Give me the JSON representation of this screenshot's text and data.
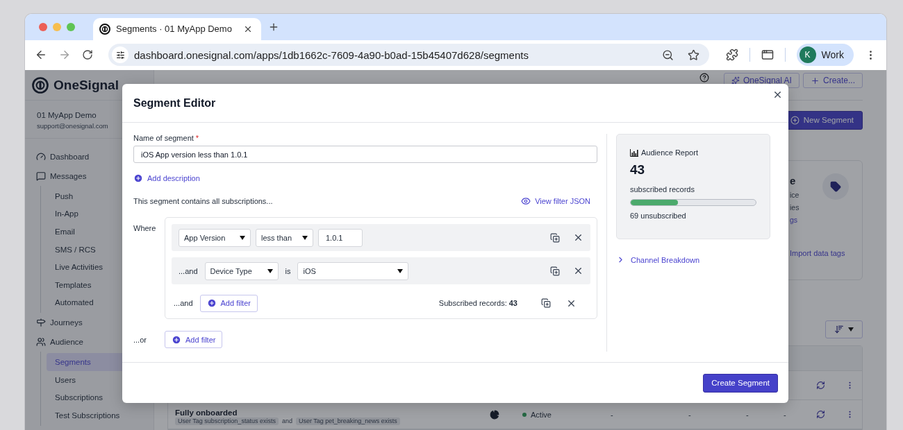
{
  "browser": {
    "tabs": [
      {
        "title": "Segments · 01 MyApp Demo",
        "selected": true
      }
    ],
    "url": "dashboard.onesignal.com/apps/1db1662c-7609-4a90-b0ad-15b45407d628/segments",
    "profile": {
      "initial": "K",
      "label": "Work"
    }
  },
  "sidebar": {
    "brand": "OneSignal",
    "app_name": "01 MyApp Demo",
    "email": "support@onesignal.com",
    "items": [
      {
        "label": "Dashboard",
        "selected": false
      },
      {
        "label": "Messages",
        "selected": false,
        "children": [
          {
            "label": "Push",
            "selected": false
          },
          {
            "label": "In-App",
            "selected": false
          },
          {
            "label": "Email",
            "selected": false
          },
          {
            "label": "SMS / RCS",
            "selected": false
          },
          {
            "label": "Live Activities",
            "selected": false
          },
          {
            "label": "Templates",
            "selected": false
          },
          {
            "label": "Automated",
            "selected": false
          }
        ]
      },
      {
        "label": "Journeys",
        "selected": false
      },
      {
        "label": "Audience",
        "selected": false,
        "children": [
          {
            "label": "Segments",
            "selected": true
          },
          {
            "label": "Users",
            "selected": false
          },
          {
            "label": "Subscriptions",
            "selected": false
          },
          {
            "label": "Test Subscriptions",
            "selected": false
          }
        ]
      }
    ]
  },
  "header": {
    "buttons": [
      {
        "kind": "ai",
        "label": "OneSignal AI"
      },
      {
        "kind": "create",
        "label": "Create..."
      }
    ]
  },
  "page": {
    "new_segment": "New Segment",
    "card": {
      "title": "e",
      "lines": [
        "ice",
        "ies"
      ],
      "link": "gs",
      "action": "Import data tags"
    },
    "table": {
      "rows": [
        {
          "kind": "covered"
        },
        {
          "kind": "full",
          "name": "Fully onboarded",
          "tags": [
            "User Tag subscription_status exists",
            "User Tag pet_breaking_news exists"
          ],
          "joiner": "and",
          "status": "Active",
          "cells": [
            "-",
            "-",
            "-",
            "-"
          ]
        }
      ]
    }
  },
  "modal": {
    "title": "Segment Editor",
    "name_label": "Name of segment",
    "required": true,
    "required_mark": "*",
    "name_value": "iOS App version less than 1.0.1",
    "add_description": "Add description",
    "summary": "This segment contains all subscriptions...",
    "view_json": "View filter JSON",
    "where": "Where",
    "filters": [
      {
        "kind": "text_value",
        "field": "App Version",
        "operator": "less than",
        "value": "1.0.1"
      },
      {
        "kind": "select_value",
        "connector": "...and",
        "field": "Device Type",
        "operator": "is",
        "value": "iOS"
      }
    ],
    "and_row": {
      "connector": "...and",
      "button": "Add filter",
      "count_label": "Subscribed records:",
      "count": "43"
    },
    "or_row": {
      "connector": "...or",
      "button": "Add filter"
    },
    "report": {
      "title": "Audience Report",
      "count": "43",
      "label": "subscribed records",
      "level": 0.38,
      "unsubscribed": "69 unsubscribed"
    },
    "breakdown": {
      "label": "Channel Breakdown",
      "expanded": false
    },
    "submit": "Create Segment"
  }
}
